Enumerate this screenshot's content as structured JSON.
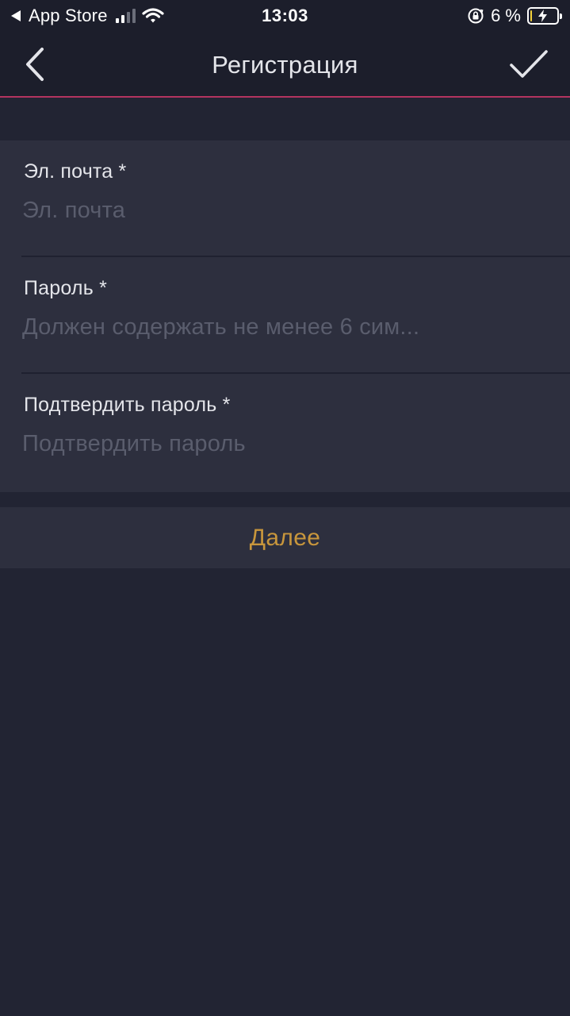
{
  "status_bar": {
    "back_app": "App Store",
    "time": "13:03",
    "battery": "6 %",
    "battery_level": 0.06
  },
  "nav": {
    "title": "Регистрация",
    "back_icon": "chevron-left-icon",
    "confirm_icon": "checkmark-icon"
  },
  "form": {
    "fields": [
      {
        "label": "Эл. почта *",
        "value": "",
        "placeholder": "Эл. почта"
      },
      {
        "label": "Пароль *",
        "value": "",
        "placeholder": "Должен содержать не менее 6 сим..."
      },
      {
        "label": "Подтвердить пароль *",
        "value": "",
        "placeholder": "Подтвердить пароль"
      }
    ]
  },
  "next_button": {
    "label": "Далее"
  },
  "colors": {
    "background": "#222433",
    "bar": "#1c1e2b",
    "panel": "#2d2f3e",
    "accent_line": "#b3335f",
    "next_text": "#c8963c",
    "placeholder": "#5a5d6d"
  }
}
